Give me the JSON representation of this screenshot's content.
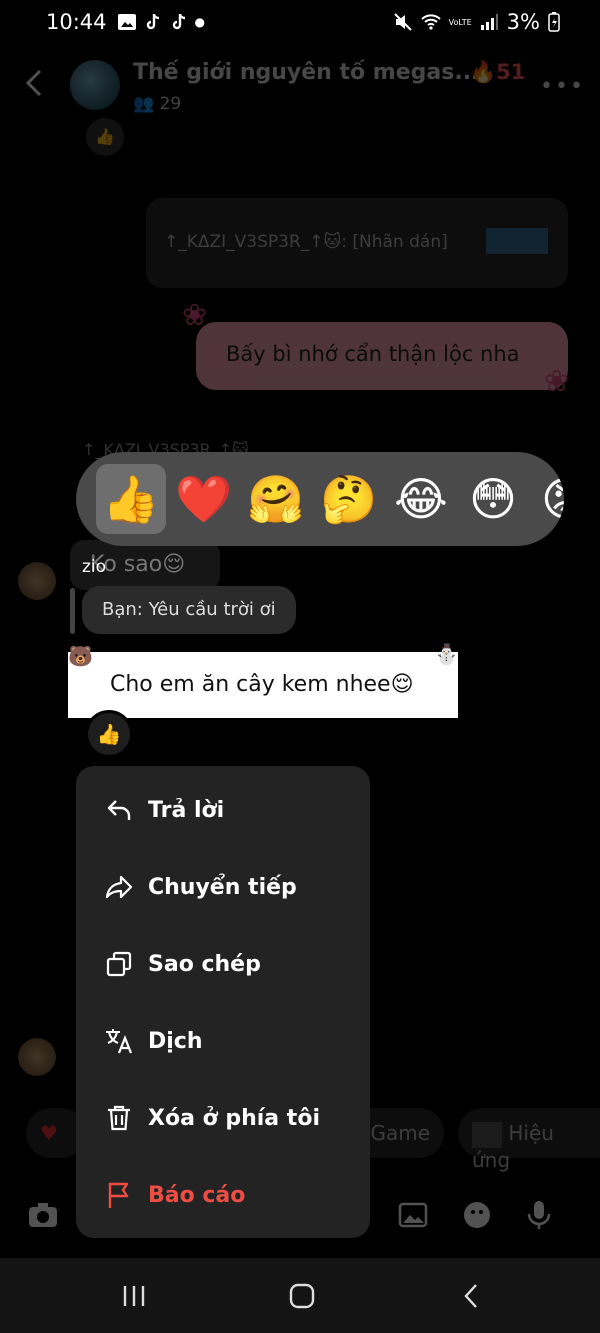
{
  "status_bar": {
    "time": "10:44",
    "battery": "3%",
    "network_label": "VoLTE"
  },
  "header": {
    "group_name": "Thế giới nguyên tố megas...",
    "streak": "51",
    "member_count": "29",
    "more": "•••"
  },
  "background_chat": {
    "reply_card_text": "↑_KΔZI_V3SP3R_↑🐱: [Nhãn dán]",
    "pink_message": "Bấy bì nhớ cẩn thận lộc nha",
    "dim_sender": "↑_KΔZI_V3SP3R_↑🐱",
    "bottom_pills": [
      "Game",
      "Hiệu ứng"
    ]
  },
  "reactions": [
    "👍",
    "❤️",
    "🤗",
    "🤔",
    "😂",
    "😳",
    "😡"
  ],
  "highlighted": {
    "sender": "zio",
    "previous_message": "Ko sao😌",
    "reply_preview": "Bạn: Yêu cầu trời ơi",
    "message": "Cho em ăn cây kem nhee😌",
    "reaction_badge": "👍"
  },
  "menu": {
    "items": [
      {
        "label": "Trả lời",
        "icon": "reply-icon"
      },
      {
        "label": "Chuyển tiếp",
        "icon": "forward-icon"
      },
      {
        "label": "Sao chép",
        "icon": "copy-icon"
      },
      {
        "label": "Dịch",
        "icon": "translate-icon"
      },
      {
        "label": "Xóa ở phía tôi",
        "icon": "trash-icon"
      },
      {
        "label": "Báo cáo",
        "icon": "flag-icon"
      }
    ]
  },
  "colors": {
    "menu_bg": "#232323",
    "danger": "#ee4d43",
    "reaction_bar": "#4a4a4a",
    "pink_bubble": "#f4a6b6"
  }
}
